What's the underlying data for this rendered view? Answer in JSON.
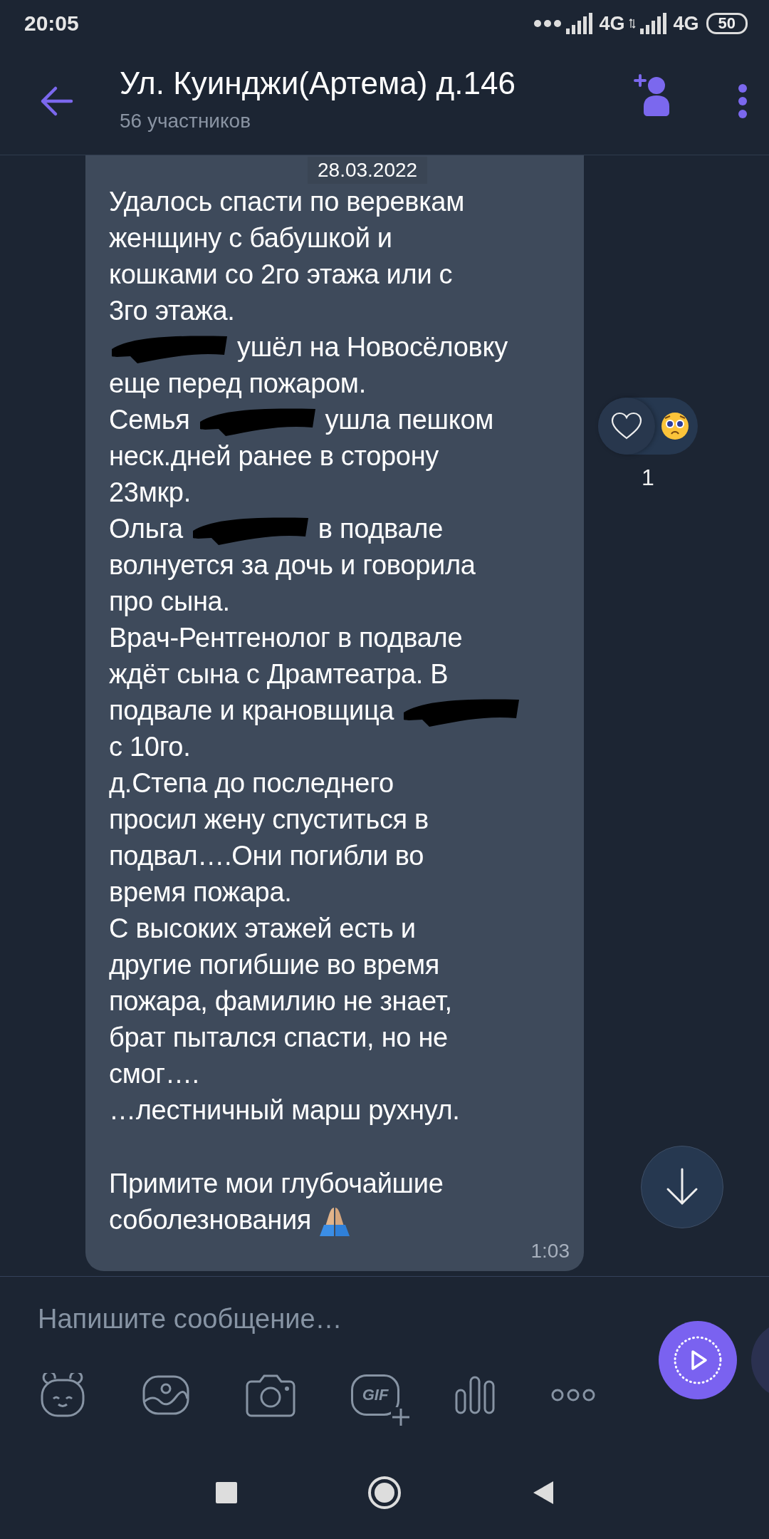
{
  "status_bar": {
    "time": "20:05",
    "network_1": "4G",
    "network_2": "4G",
    "battery": "50"
  },
  "header": {
    "title": "Ул. Куинджи(Артема) д.146",
    "subtitle": "56 участников"
  },
  "date_chip": "28.03.2022",
  "message": {
    "blocks": [
      {
        "lines": [
          [
            {
              "kind": "text",
              "text": "Удалось спасти по веревкам"
            }
          ],
          [
            {
              "kind": "text",
              "text": "женщину с бабушкой и"
            }
          ],
          [
            {
              "kind": "text",
              "text": "кошками со 2го этажа или с"
            }
          ],
          [
            {
              "kind": "text",
              "text": "3го этажа."
            }
          ],
          [
            {
              "kind": "redaction"
            },
            {
              "kind": "text",
              "text": "ушёл на Новосёловку"
            }
          ],
          [
            {
              "kind": "text",
              "text": "еще перед пожаром."
            }
          ],
          [
            {
              "kind": "text",
              "text": "Семья"
            },
            {
              "kind": "redaction"
            },
            {
              "kind": "text",
              "text": "ушла пешком"
            }
          ],
          [
            {
              "kind": "text",
              "text": "неск.дней ранее в сторону"
            }
          ],
          [
            {
              "kind": "text",
              "text": "23мкр."
            }
          ],
          [
            {
              "kind": "text",
              "text": "Ольга"
            },
            {
              "kind": "redaction"
            },
            {
              "kind": "text",
              "text": "в подвале"
            }
          ],
          [
            {
              "kind": "text",
              "text": "волнуется за дочь и говорила"
            }
          ],
          [
            {
              "kind": "text",
              "text": "про сына."
            }
          ],
          [
            {
              "kind": "text",
              "text": "Врач-Рентгенолог в подвале"
            }
          ],
          [
            {
              "kind": "text",
              "text": "ждёт сына с Драмтеатра. В"
            }
          ],
          [
            {
              "kind": "text",
              "text": "подвале и крановщица"
            },
            {
              "kind": "redaction"
            }
          ],
          [
            {
              "kind": "text",
              "text": "с 10го."
            }
          ],
          [
            {
              "kind": "text",
              "text": "д.Степа до последнего"
            }
          ],
          [
            {
              "kind": "text",
              "text": "просил жену спуститься в"
            }
          ],
          [
            {
              "kind": "text",
              "text": "подвал….Они погибли во"
            }
          ],
          [
            {
              "kind": "text",
              "text": "время пожара."
            }
          ],
          [
            {
              "kind": "text",
              "text": "С высоких этажей есть и"
            }
          ],
          [
            {
              "kind": "text",
              "text": "другие погибшие во время"
            }
          ],
          [
            {
              "kind": "text",
              "text": "пожара, фамилию не знает,"
            }
          ],
          [
            {
              "kind": "text",
              "text": "брат пытался спасти, но не"
            }
          ],
          [
            {
              "kind": "text",
              "text": "смог…."
            }
          ],
          [
            {
              "kind": "text",
              "text": "…лестничный марш рухнул."
            }
          ]
        ]
      },
      {
        "lines": [
          [
            {
              "kind": "text",
              "text": "Примите мои глубочайшие"
            }
          ],
          [
            {
              "kind": "text",
              "text": "соболезнования"
            },
            {
              "kind": "emoji"
            }
          ]
        ]
      }
    ],
    "time": "1:03"
  },
  "reaction": {
    "count": "1"
  },
  "composer": {
    "placeholder": "Напишите сообщение…",
    "gif_label": "GIF"
  }
}
